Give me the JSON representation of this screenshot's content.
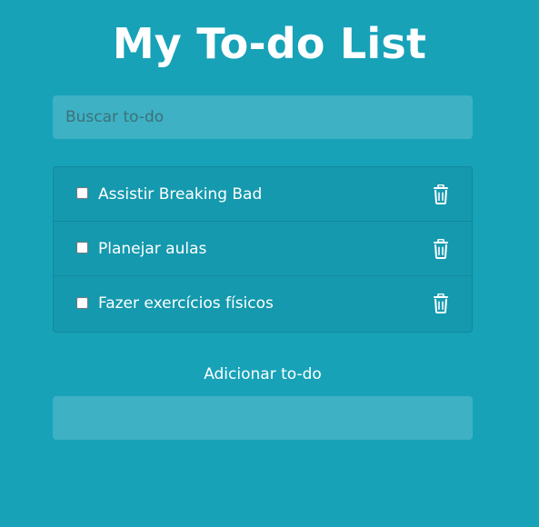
{
  "header": {
    "title": "My To-do List"
  },
  "search": {
    "placeholder": "Buscar to-do",
    "value": ""
  },
  "todos": [
    {
      "label": "Assistir Breaking Bad",
      "checked": false,
      "icon": "trash-icon"
    },
    {
      "label": "Planejar aulas",
      "checked": false,
      "icon": "trash-icon"
    },
    {
      "label": "Fazer exercícios físicos",
      "checked": false,
      "icon": "trash-icon"
    }
  ],
  "add": {
    "label": "Adicionar to-do",
    "value": ""
  },
  "colors": {
    "background": "#17a2b8",
    "list_background": "#1599ae",
    "text": "#ffffff"
  }
}
